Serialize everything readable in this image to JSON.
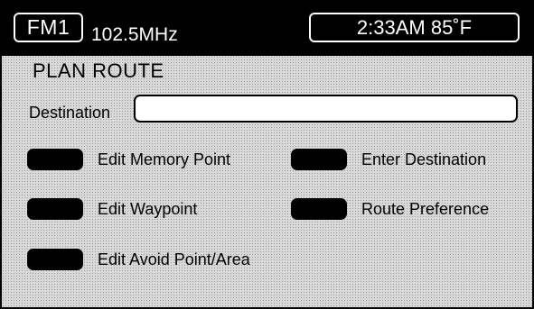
{
  "status_bar": {
    "band": "FM1",
    "frequency": "102.5MHz",
    "clock": "2:33AM 85˚F"
  },
  "page": {
    "title": "PLAN ROUTE"
  },
  "destination": {
    "label": "Destination",
    "value": ""
  },
  "menu": {
    "edit_memory_point": "Edit Memory Point",
    "enter_destination": "Enter Destination",
    "edit_waypoint": "Edit Waypoint",
    "route_preference": "Route Preference",
    "edit_avoid_point_area": "Edit Avoid Point/Area"
  }
}
